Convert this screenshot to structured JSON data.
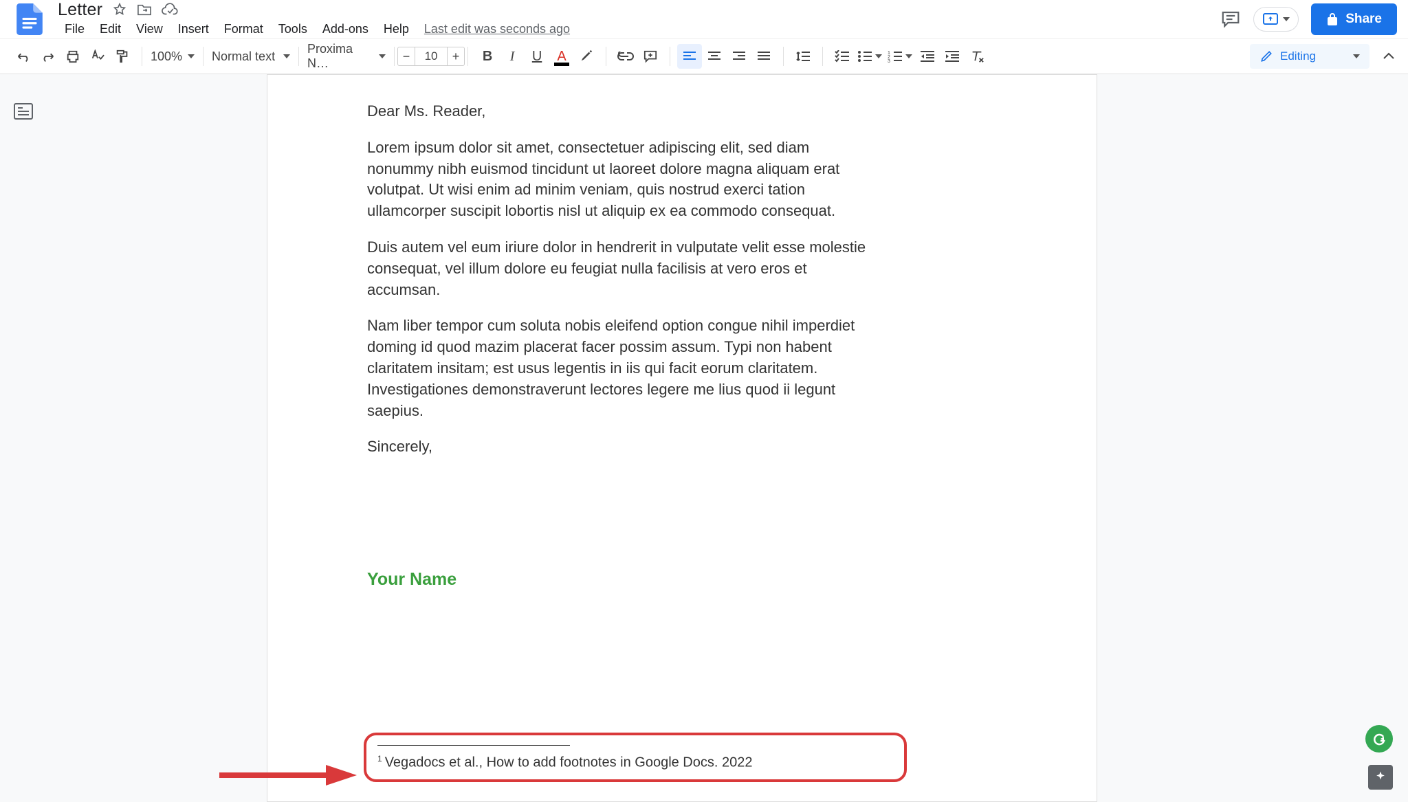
{
  "header": {
    "doc_title": "Letter",
    "menu": [
      "File",
      "Edit",
      "View",
      "Insert",
      "Format",
      "Tools",
      "Add-ons",
      "Help"
    ],
    "last_edit": "Last edit was seconds ago",
    "share_label": "Share"
  },
  "toolbar": {
    "zoom": "100%",
    "style": "Normal text",
    "font": "Proxima N…",
    "font_size": "10",
    "editing_label": "Editing"
  },
  "doc": {
    "greeting": "Dear Ms. Reader,",
    "p1": "Lorem ipsum dolor sit amet, consectetuer adipiscing elit, sed diam nonummy nibh euismod tincidunt ut laoreet dolore magna aliquam erat volutpat. Ut wisi enim ad minim veniam, quis nostrud exerci tation ullamcorper suscipit lobortis nisl ut aliquip ex ea commodo consequat.",
    "p2": "Duis autem vel eum iriure dolor in hendrerit in vulputate velit esse molestie consequat, vel illum dolore eu feugiat nulla facilisis at vero eros et accumsan.",
    "p3": "Nam liber tempor cum soluta nobis eleifend option congue nihil imperdiet doming id quod mazim placerat facer possim assum. Typi non habent claritatem insitam; est usus legentis in iis qui facit eorum claritatem. Investigationes demonstraverunt lectores legere me lius quod ii legunt saepius.",
    "closing": "Sincerely,",
    "signature": "Your Name"
  },
  "footnote": {
    "ref": "1",
    "text": "Vegadocs et al., How to add footnotes in Google Docs. 2022"
  }
}
